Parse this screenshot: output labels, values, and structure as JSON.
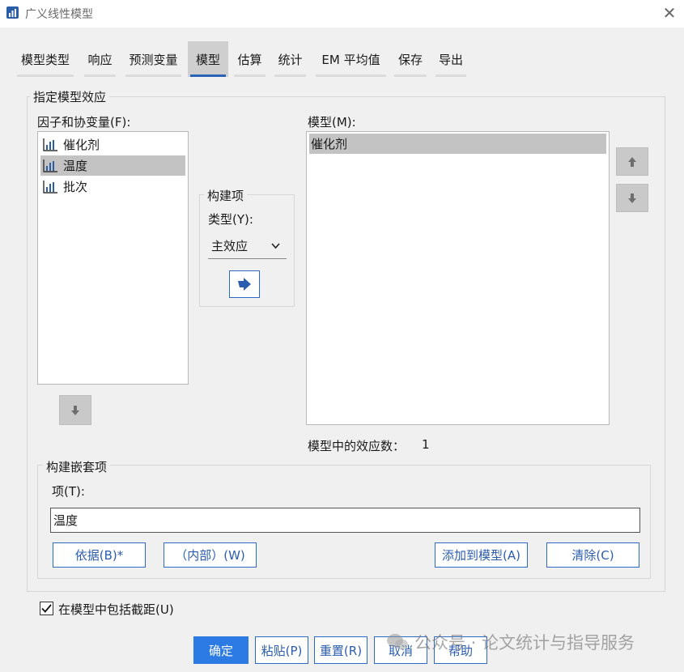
{
  "window": {
    "title": "广义线性模型",
    "close_glyph": "✕"
  },
  "tabs": [
    {
      "label": "模型类型"
    },
    {
      "label": "响应"
    },
    {
      "label": "预测变量"
    },
    {
      "label": "模型"
    },
    {
      "label": "估算"
    },
    {
      "label": "统计"
    },
    {
      "label": "EM 平均值"
    },
    {
      "label": "保存"
    },
    {
      "label": "导出"
    }
  ],
  "specify_effects": {
    "legend": "指定模型效应",
    "factors_label": "因子和协变量(F):",
    "factors": [
      {
        "label": "催化剂",
        "selected": false,
        "icon": "bar-chart-variable-icon"
      },
      {
        "label": "温度",
        "selected": true,
        "icon": "bar-chart-variable-icon"
      },
      {
        "label": "批次",
        "selected": false,
        "icon": "bar-chart-variable-icon"
      }
    ],
    "build_term": {
      "legend": "构建项",
      "type_label": "类型(Y):",
      "type_value": "主效应",
      "move_icon": "arrow-right-icon"
    },
    "model_label": "模型(M):",
    "model_terms": [
      {
        "label": "催化剂",
        "selected": true
      }
    ],
    "effects_count_label": "模型中的效应数：",
    "effects_count": "1"
  },
  "nested": {
    "legend": "构建嵌套项",
    "term_label": "项(T):",
    "term_value": "温度",
    "buttons": {
      "by": "依据(B)*",
      "within": "（内部）(W)",
      "add": "添加到模型(A)",
      "clear": "清除(C)"
    }
  },
  "include_intercept": {
    "label": "在模型中包括截距(U)",
    "checked": true
  },
  "footer": {
    "ok": "确定",
    "paste": "粘贴(P)",
    "reset": "重置(R)",
    "cancel": "取消",
    "help": "帮助"
  },
  "watermark": "公众号 · 论文统计与指导服务",
  "colors": {
    "accent": "#2c7be5",
    "selection": "#c3c3c3",
    "tab_indicator": "#2a62b8"
  }
}
